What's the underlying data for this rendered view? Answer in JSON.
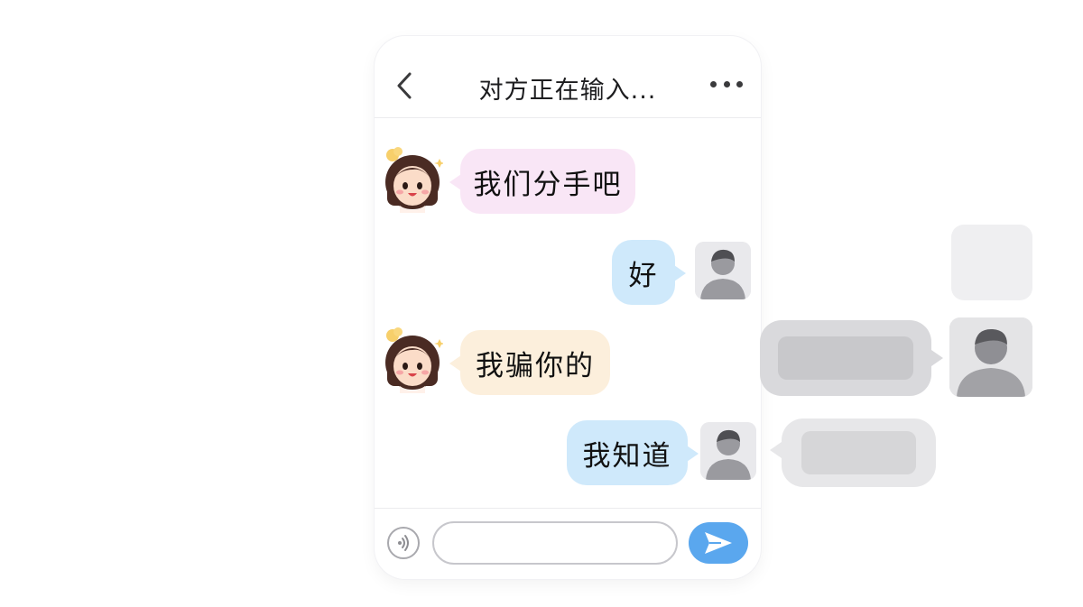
{
  "header": {
    "title": "对方正在输入...",
    "back_icon": "chevron-left-icon",
    "more_icon": "more-horizontal-icon"
  },
  "messages": [
    {
      "sender": "other",
      "text": "我们分手吧",
      "bubble_color": "#f9e6f6"
    },
    {
      "sender": "me",
      "text": "好",
      "bubble_color": "#cfe9fb"
    },
    {
      "sender": "other",
      "text": "我骗你的",
      "bubble_color": "#fcefdc"
    },
    {
      "sender": "me",
      "text": "我知道",
      "bubble_color": "#cfe9fb"
    }
  ],
  "composer": {
    "placeholder": "",
    "value": "",
    "voice_icon": "voice-icon",
    "send_icon": "send-icon",
    "send_color": "#5aa7ee"
  }
}
